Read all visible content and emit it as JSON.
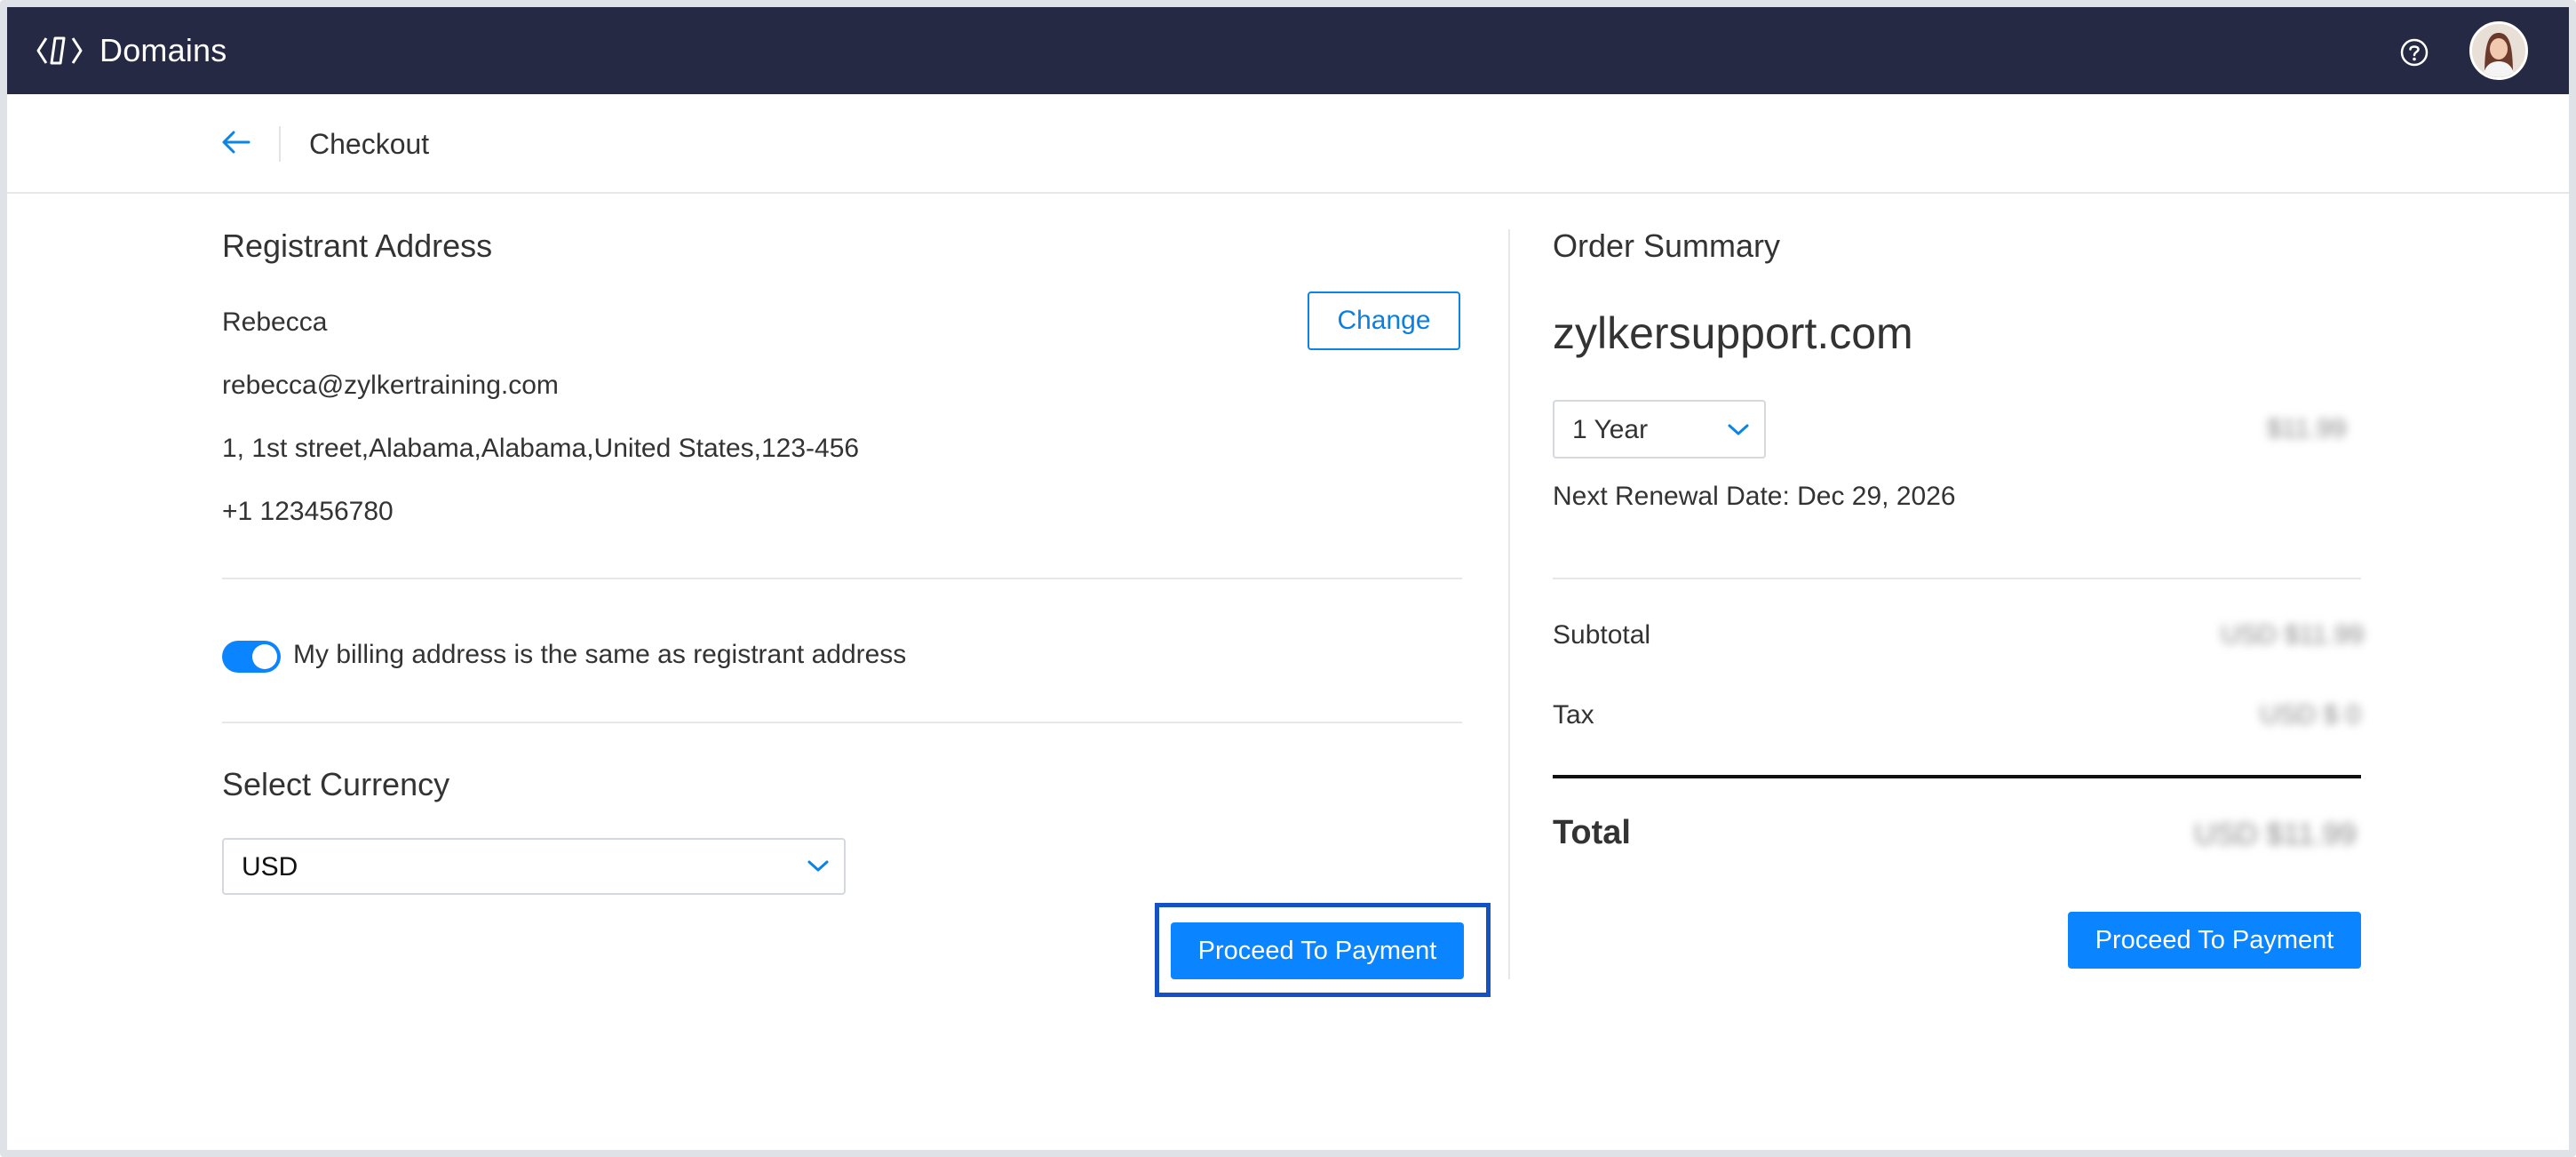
{
  "app": {
    "name": "Domains"
  },
  "header": {
    "title": "Checkout"
  },
  "registrant": {
    "heading": "Registrant Address",
    "name": "Rebecca",
    "email": "rebecca@zylkertraining.com",
    "address": "1, 1st street,Alabama,Alabama,United States,123-456",
    "phone": "+1 123456780",
    "change_label": "Change"
  },
  "billing": {
    "same_as_registrant_label": "My billing address is the same as registrant address",
    "enabled": true
  },
  "currency": {
    "heading": "Select Currency",
    "selected": "USD"
  },
  "actions": {
    "proceed_label": "Proceed To Payment"
  },
  "order": {
    "heading": "Order Summary",
    "domain": "zylkersupport.com",
    "term": "1 Year",
    "term_price": "$11.99",
    "renewal_label": "Next Renewal Date: Dec 29, 2026",
    "subtotal_label": "Subtotal",
    "subtotal_value": "USD $11.99",
    "tax_label": "Tax",
    "tax_value": "USD $ 0",
    "total_label": "Total",
    "total_value": "USD $11.99",
    "proceed_label": "Proceed To Payment"
  },
  "colors": {
    "topbar": "#252944",
    "accent": "#0a84ff",
    "focus": "#1452c4"
  },
  "icons": {
    "logo": "domains-logo-icon",
    "help": "help-icon",
    "back": "back-arrow-icon",
    "chevron": "chevron-down-icon"
  }
}
